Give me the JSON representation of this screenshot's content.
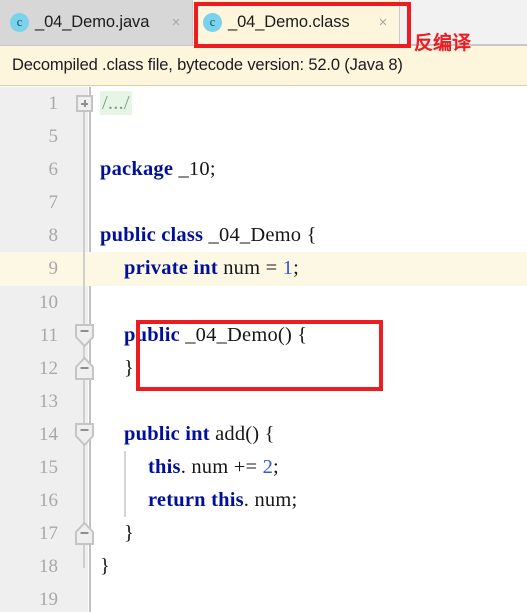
{
  "tabs": [
    {
      "label": "_04_Demo.java",
      "icon": "java-class-icon",
      "icon_letter": "c",
      "close": "×",
      "active": false
    },
    {
      "label": "_04_Demo.class",
      "icon": "java-class-icon",
      "icon_letter": "c",
      "close": "×",
      "active": true
    }
  ],
  "annotation": {
    "text": "反编译",
    "color": "#ee1b21"
  },
  "banner": {
    "text": "Decompiled .class file, bytecode version: 52.0 (Java 8)",
    "background": "#fdf6dd"
  },
  "editor": {
    "caret_line": 9,
    "gutter_background": "#efefef",
    "caret_line_background": "#fdf8e3",
    "keyword_color": "#00109a",
    "number_color": "#3a56d4",
    "lines": [
      {
        "no": "1",
        "indent": 0,
        "tokens": [
          {
            "t": "fold",
            "v": "/.../"
          }
        ]
      },
      {
        "no": "5",
        "indent": 0,
        "tokens": []
      },
      {
        "no": "6",
        "indent": 0,
        "tokens": [
          {
            "t": "kw",
            "v": "package"
          },
          {
            "t": "plain",
            "v": " _10;"
          }
        ]
      },
      {
        "no": "7",
        "indent": 0,
        "tokens": []
      },
      {
        "no": "8",
        "indent": 0,
        "tokens": [
          {
            "t": "kw",
            "v": "public class"
          },
          {
            "t": "plain",
            "v": " _04_Demo {"
          }
        ]
      },
      {
        "no": "9",
        "indent": 1,
        "tokens": [
          {
            "t": "kw",
            "v": "private int"
          },
          {
            "t": "plain",
            "v": " num = "
          },
          {
            "t": "num",
            "v": "1"
          },
          {
            "t": "plain",
            "v": ";"
          }
        ]
      },
      {
        "no": "10",
        "indent": 0,
        "tokens": []
      },
      {
        "no": "11",
        "indent": 1,
        "tokens": [
          {
            "t": "kw",
            "v": "public"
          },
          {
            "t": "plain",
            "v": " _04_Demo() {"
          }
        ]
      },
      {
        "no": "12",
        "indent": 1,
        "tokens": [
          {
            "t": "plain",
            "v": "}"
          }
        ]
      },
      {
        "no": "13",
        "indent": 0,
        "tokens": []
      },
      {
        "no": "14",
        "indent": 1,
        "tokens": [
          {
            "t": "kw",
            "v": "public int"
          },
          {
            "t": "plain",
            "v": " add() {"
          }
        ]
      },
      {
        "no": "15",
        "indent": 2,
        "tokens": [
          {
            "t": "kw",
            "v": "this"
          },
          {
            "t": "plain",
            "v": ". num += "
          },
          {
            "t": "num",
            "v": "2"
          },
          {
            "t": "plain",
            "v": ";"
          }
        ]
      },
      {
        "no": "16",
        "indent": 2,
        "tokens": [
          {
            "t": "kw",
            "v": "return this"
          },
          {
            "t": "plain",
            "v": ". num;"
          }
        ]
      },
      {
        "no": "17",
        "indent": 1,
        "tokens": [
          {
            "t": "plain",
            "v": "}"
          }
        ]
      },
      {
        "no": "18",
        "indent": 0,
        "tokens": [
          {
            "t": "plain",
            "v": "}"
          }
        ]
      },
      {
        "no": "19",
        "indent": 0,
        "tokens": []
      }
    ]
  }
}
